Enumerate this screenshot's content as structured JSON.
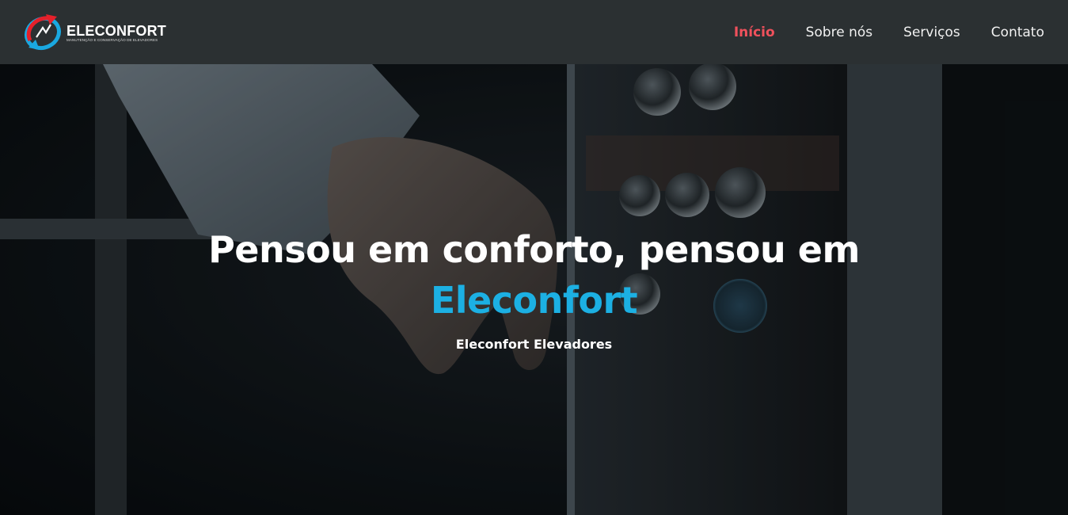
{
  "brand": {
    "name": "ELECONFORT",
    "tagline": "MANUTENÇÃO E CONSERVAÇÃO DE ELEVADORES",
    "colors": {
      "red": "#e5202a",
      "blue": "#1aa8e0"
    }
  },
  "nav": {
    "items": [
      {
        "label": "Início",
        "active": true
      },
      {
        "label": "Sobre nós",
        "active": false
      },
      {
        "label": "Serviços",
        "active": false
      },
      {
        "label": "Contato",
        "active": false
      }
    ],
    "active_color": "#f0515c",
    "background": "#2b3032"
  },
  "hero": {
    "title_line1": "Pensou em conforto, pensou em",
    "title_highlight": "Eleconfort",
    "subtitle": "Eleconfort Elevadores",
    "highlight_color": "#1cb0e3",
    "background_description_icon": "hand-pressing-elevator-button-photo"
  }
}
